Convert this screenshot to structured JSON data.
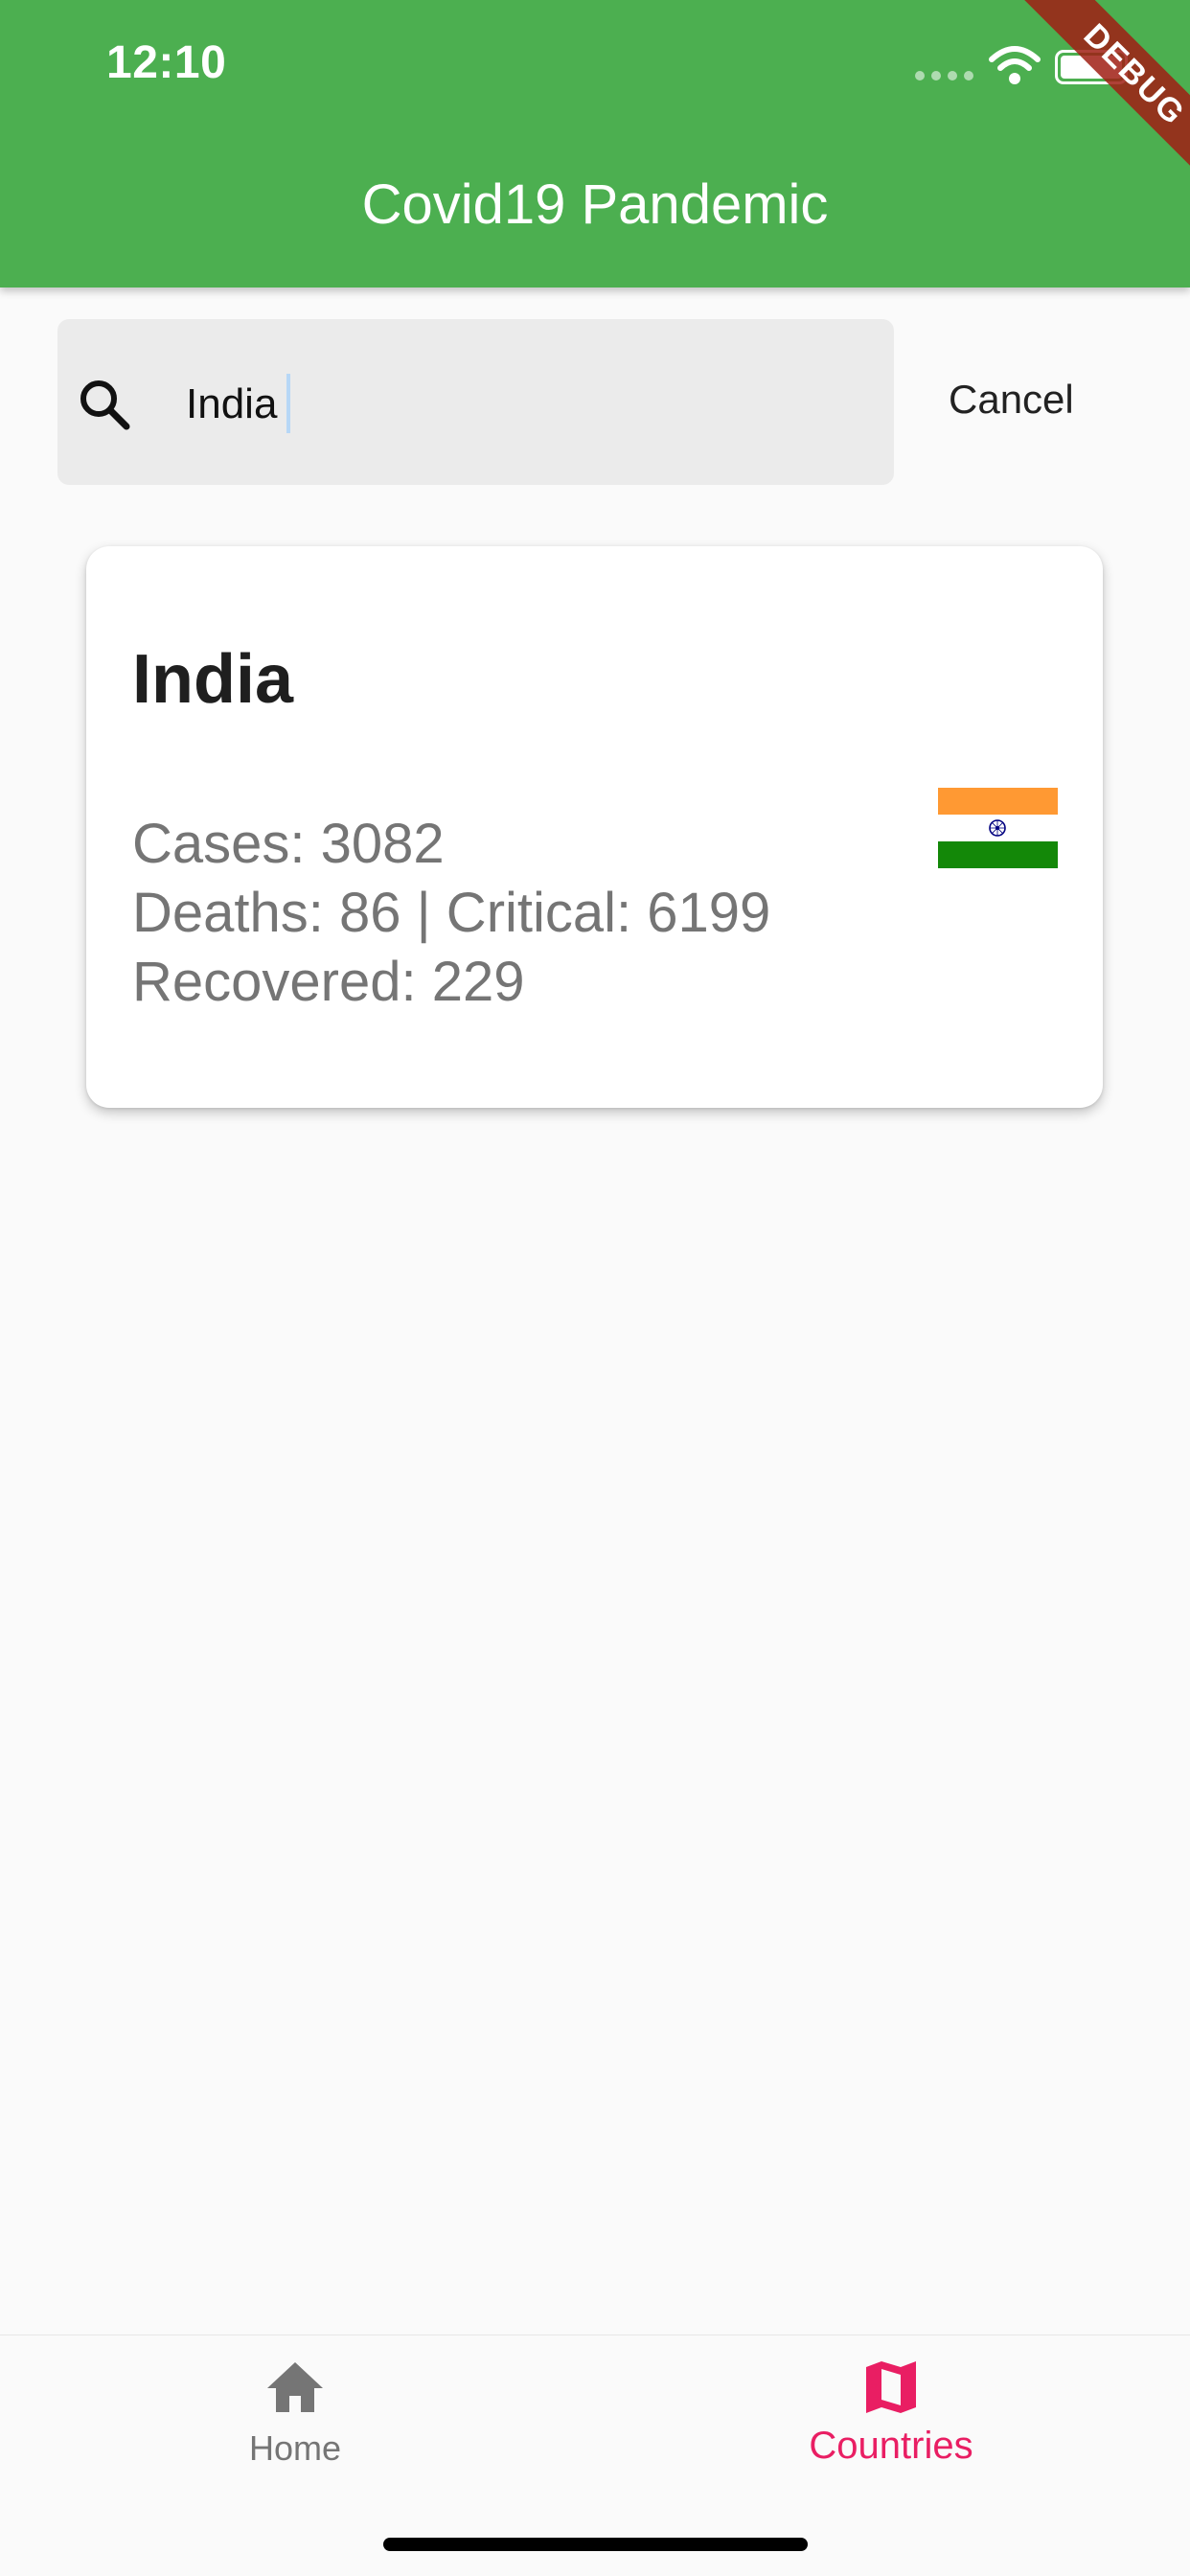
{
  "status_bar": {
    "time": "12:10"
  },
  "app_bar": {
    "title": "Covid19 Pandemic",
    "color": "#4CAF50"
  },
  "debug_banner": {
    "label": "DEBUG"
  },
  "search": {
    "value": "India",
    "cancel_label": "Cancel",
    "icon": "search-icon"
  },
  "country_card": {
    "name": "India",
    "cases_text": "Cases: 3082",
    "deaths_critical_text": "Deaths: 86 | Critical: 6199",
    "recovered_text": "Recovered: 229",
    "flag": "india-flag-icon"
  },
  "bottom_nav": {
    "items": [
      {
        "label": "Home",
        "icon": "home-icon",
        "active": false
      },
      {
        "label": "Countries",
        "icon": "map-icon",
        "active": true
      }
    ],
    "active_color": "#E91E63",
    "inactive_color": "#757575"
  }
}
